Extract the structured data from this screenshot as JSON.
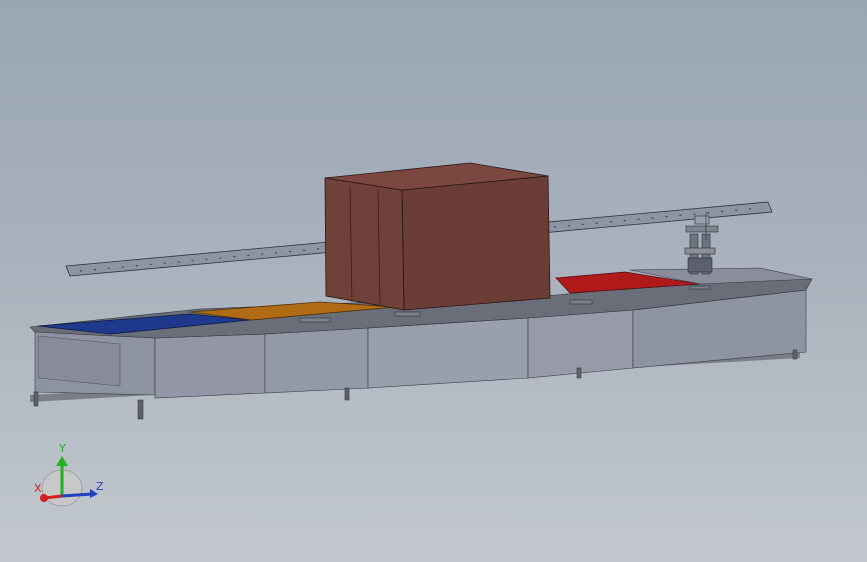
{
  "viewport": {
    "background_top": "#9aa6b4",
    "background_bottom": "#c3c8ce"
  },
  "model": {
    "tank_colors": {
      "blue": "#1f3a8c",
      "orange": "#b06c14",
      "red": "#b01a1a"
    },
    "housing_color": "#6a3d36",
    "frame_color": "#8a8e9c"
  },
  "triad": {
    "x_label": "X",
    "y_label": "Y",
    "z_label": "Z",
    "x_color": "#d02020",
    "y_color": "#20b020",
    "z_color": "#2040c0"
  }
}
